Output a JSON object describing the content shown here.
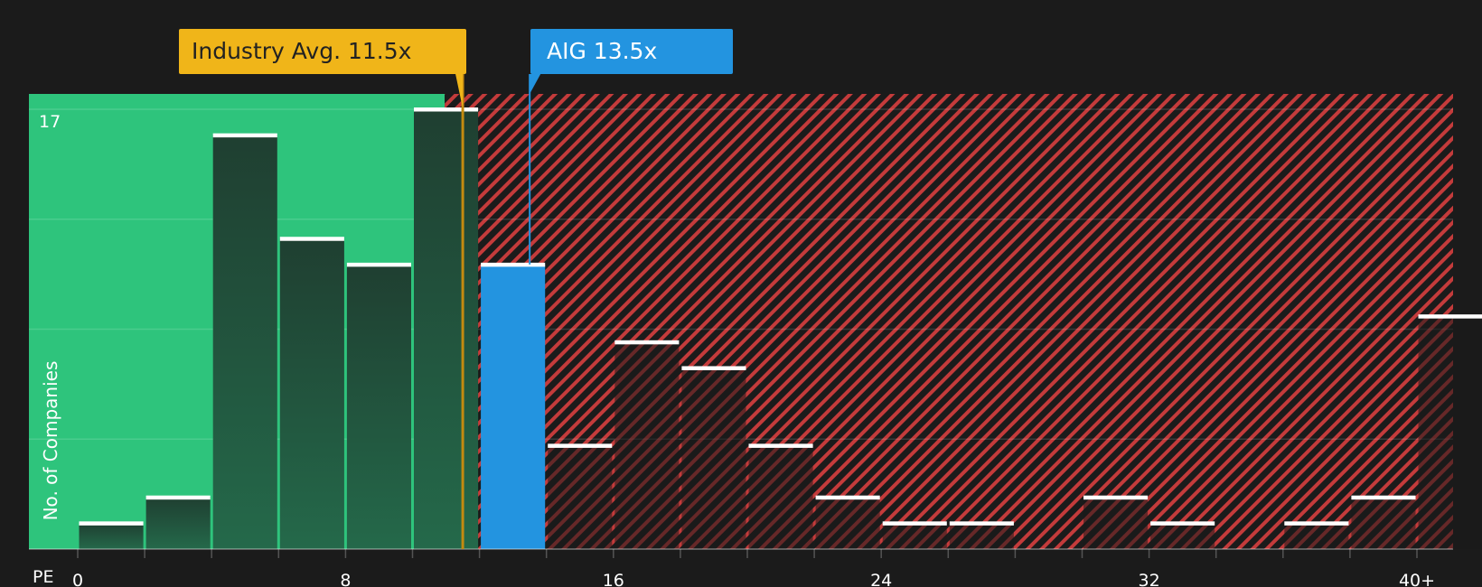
{
  "chart_data": {
    "type": "bar",
    "x_axis_name": "PE",
    "ylabel": "No. of Companies",
    "y_max_label": "17",
    "ylim": [
      0,
      17
    ],
    "grid": true,
    "x_ticks": [
      "0",
      "8",
      "16",
      "24",
      "32",
      "40+"
    ],
    "bins": [
      {
        "start": 0,
        "end": 2,
        "count": 1
      },
      {
        "start": 2,
        "end": 4,
        "count": 2
      },
      {
        "start": 4,
        "end": 6,
        "count": 16
      },
      {
        "start": 6,
        "end": 8,
        "count": 12
      },
      {
        "start": 8,
        "end": 10,
        "count": 11
      },
      {
        "start": 10,
        "end": 12,
        "count": 17
      },
      {
        "start": 12,
        "end": 14,
        "count": 11
      },
      {
        "start": 14,
        "end": 16,
        "count": 4
      },
      {
        "start": 16,
        "end": 18,
        "count": 8
      },
      {
        "start": 18,
        "end": 20,
        "count": 7
      },
      {
        "start": 20,
        "end": 22,
        "count": 4
      },
      {
        "start": 22,
        "end": 24,
        "count": 2
      },
      {
        "start": 24,
        "end": 26,
        "count": 1
      },
      {
        "start": 26,
        "end": 28,
        "count": 1
      },
      {
        "start": 28,
        "end": 30,
        "count": 0
      },
      {
        "start": 30,
        "end": 32,
        "count": 2
      },
      {
        "start": 32,
        "end": 34,
        "count": 1
      },
      {
        "start": 34,
        "end": 36,
        "count": 0
      },
      {
        "start": 36,
        "end": 38,
        "count": 1
      },
      {
        "start": 38,
        "end": 40,
        "count": 2
      },
      {
        "start": 40,
        "end": 42,
        "count": 9
      }
    ],
    "industry_avg": {
      "label": "Industry Avg. 11.5x",
      "value": 11.5
    },
    "company": {
      "label": "AIG 13.5x",
      "value": 13.5,
      "bin_index": 6
    },
    "colors": {
      "background": "#1b1b1b",
      "fair_zone": "#2ec47c",
      "expensive_zone": "#c43b3b",
      "industry": "#f0b519",
      "company": "#2394e0",
      "bar": "#1f4533"
    }
  }
}
